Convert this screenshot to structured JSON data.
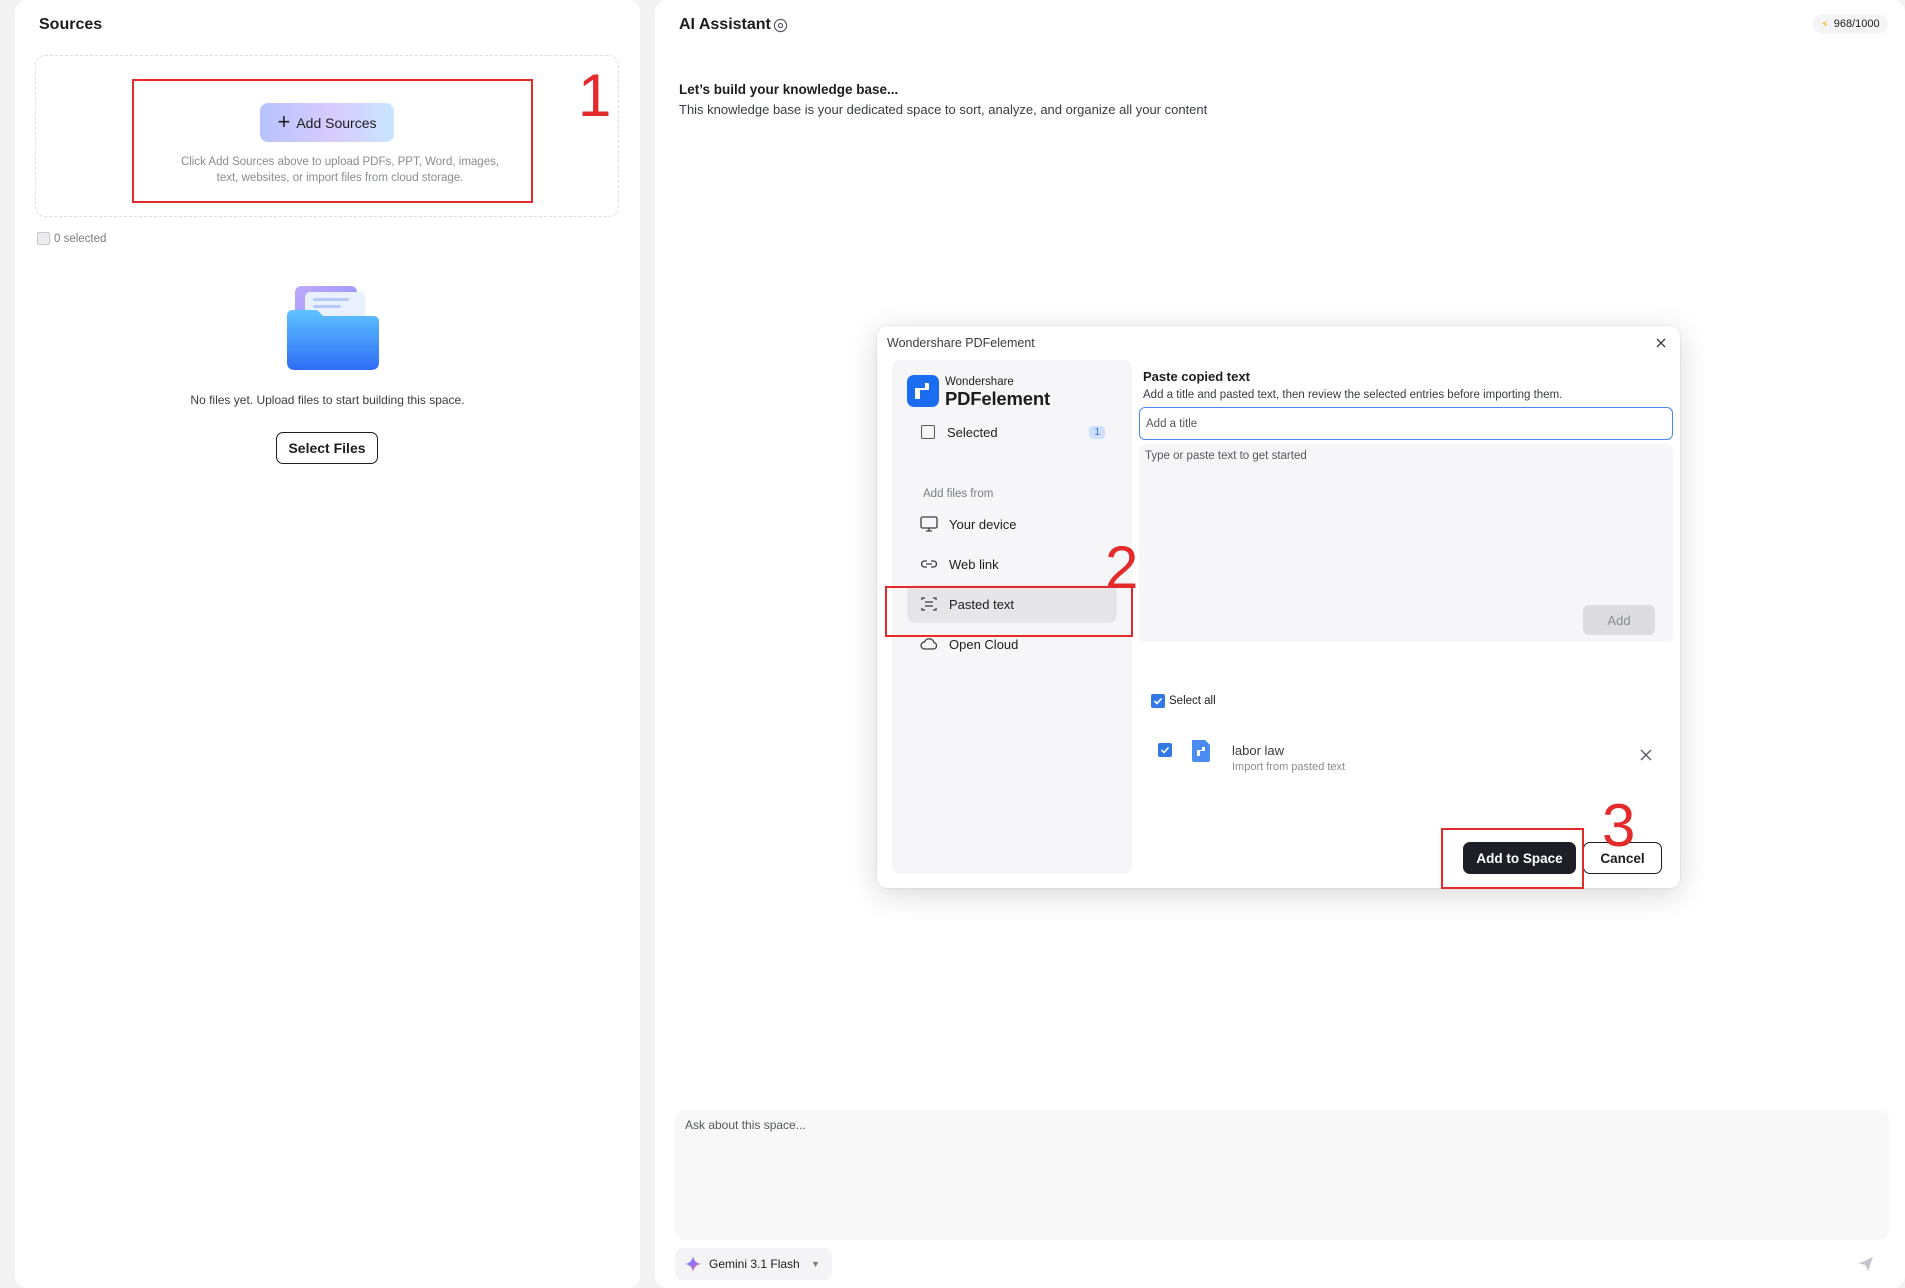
{
  "sources": {
    "title": "Sources",
    "add_sources_label": "Add Sources",
    "upload_hint_line1": "Click Add Sources above to upload PDFs, PPT, Word, images,",
    "upload_hint_line2": "text, websites, or import files from cloud storage.",
    "selected_count": "0 selected",
    "empty_text": "No files yet. Upload files to start building this space.",
    "select_files_label": "Select Files"
  },
  "ai": {
    "title": "AI Assistant",
    "credits": "968/1000",
    "kb_heading": "Let’s build your knowledge base...",
    "kb_sub": "This knowledge base is your dedicated space to sort, analyze, and organize all your content",
    "chat_placeholder": "Ask about this space...",
    "model": "Gemini 3.1 Flash"
  },
  "dialog": {
    "title": "Wondershare PDFelement",
    "brand_small": "Wondershare",
    "brand_big": "PDFelement",
    "sidebar": {
      "selected_label": "Selected",
      "selected_count": "1",
      "section_label": "Add files from",
      "items": [
        {
          "label": "Your device",
          "icon": "monitor-icon"
        },
        {
          "label": "Web link",
          "icon": "link-icon"
        },
        {
          "label": "Pasted text",
          "icon": "paste-text-icon"
        },
        {
          "label": "Open Cloud",
          "icon": "cloud-icon"
        }
      ]
    },
    "paste": {
      "heading": "Paste copied text",
      "subtitle": "Add a title and pasted text, then review the selected entries before importing them.",
      "title_placeholder": "Add a title",
      "text_placeholder": "Type or paste text to get started",
      "add_label": "Add"
    },
    "select_all_label": "Select all",
    "entries": [
      {
        "title": "labor law",
        "subtitle": "Import from pasted text"
      }
    ],
    "add_to_space_label": "Add to Space",
    "cancel_label": "Cancel"
  },
  "annotations": [
    "1",
    "2",
    "3"
  ],
  "colors": {
    "accent_blue": "#3478e5",
    "annotation_red": "#e32b2b",
    "primary_dark": "#1e1f26"
  }
}
